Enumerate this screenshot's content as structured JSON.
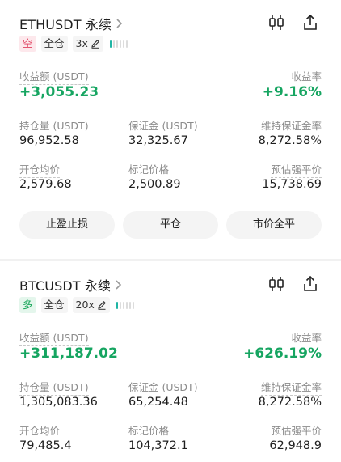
{
  "positions": [
    {
      "symbol": "ETHUSDT 永续",
      "side": "空",
      "margin_mode": "全仓",
      "leverage": "3x",
      "risk_level": 0.25,
      "pnl_label": "收益额 (USDT)",
      "pnl_value": "+3,055.23",
      "roe_label": "收益率",
      "roe_value": "+9.16%",
      "size_label": "持仓量 (USDT)",
      "size_value": "96,952.58",
      "margin_label": "保证金 (USDT)",
      "margin_value": "32,325.67",
      "mmr_label": "维持保证金率",
      "mmr_value": "8,272.58%",
      "entry_label": "开仓均价",
      "entry_value": "2,579.68",
      "mark_label": "标记价格",
      "mark_value": "2,500.89",
      "liq_label": "预估强平价",
      "liq_value": "15,738.69"
    },
    {
      "symbol": "BTCUSDT 永续",
      "side": "多",
      "margin_mode": "全仓",
      "leverage": "20x",
      "risk_level": 0.25,
      "pnl_label": "收益额 (USDT)",
      "pnl_value": "+311,187.02",
      "roe_label": "收益率",
      "roe_value": "+626.19%",
      "size_label": "持仓量 (USDT)",
      "size_value": "1,305,083.36",
      "margin_label": "保证金 (USDT)",
      "margin_value": "65,254.48",
      "mmr_label": "维持保证金率",
      "mmr_value": "8,272.58%",
      "entry_label": "开仓均价",
      "entry_value": "79,485.4",
      "mark_label": "标记价格",
      "mark_value": "104,372.1",
      "liq_label": "预估强平价",
      "liq_value": "62,948.9"
    }
  ],
  "buttons": {
    "tp_sl": "止盈止损",
    "close": "平仓",
    "market_close_all": "市价全平"
  },
  "colors": {
    "profit": "#16a561",
    "short_tag": "#e0415f",
    "long_tag": "#1aa75b",
    "risk_bar": "#1fb5a4"
  },
  "icons": {
    "chart": "candlestick-chart-icon",
    "share": "share-icon",
    "edit": "pencil-icon",
    "chevron": "chevron-right-icon"
  }
}
